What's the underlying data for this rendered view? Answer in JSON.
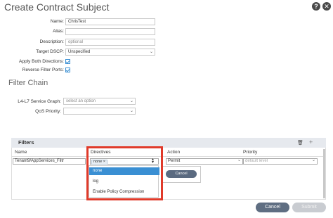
{
  "dialog": {
    "title": "Create Contract Subject",
    "help_label": "?",
    "close_label": "✕"
  },
  "form": {
    "name_label": "Name:",
    "name_value": "ChrisTest",
    "alias_label": "Alias:",
    "alias_value": "",
    "description_label": "Description:",
    "description_placeholder": "optional",
    "target_dscp_label": "Target DSCP:",
    "target_dscp_value": "Unspecified",
    "apply_both_label": "Apply Both Directions:",
    "apply_both_checked": true,
    "reverse_filter_label": "Reverse Filter Ports:",
    "reverse_filter_checked": true
  },
  "filter_chain": {
    "title": "Filter Chain",
    "service_graph_label": "L4-L7 Service Graph:",
    "service_graph_placeholder": "select an option",
    "qos_label": "QoS Priority:",
    "qos_value": ""
  },
  "filters": {
    "title": "Filters",
    "columns": [
      "Name",
      "Directives",
      "Action",
      "Priority"
    ],
    "row": {
      "name": "Tenant9/AppServices_Filtr",
      "directive_tag": "none",
      "action": "Permit",
      "priority_placeholder": "default level"
    },
    "directive_options": [
      "none",
      "log",
      "Enable Policy Compression"
    ],
    "selected_option": "none",
    "mini_cancel_label": "Cancel"
  },
  "footer": {
    "cancel_label": "Cancel",
    "submit_label": "Submit"
  },
  "colors": {
    "accent_blue": "#3a8fd3",
    "highlight_red": "#e03a2a",
    "cancel_button": "#5f6e82",
    "submit_disabled": "#c9ccd1"
  }
}
